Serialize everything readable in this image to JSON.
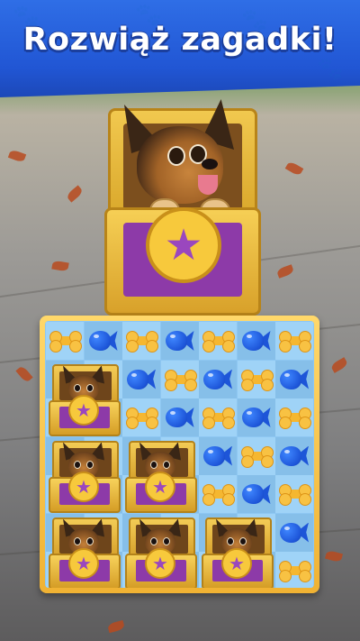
{
  "banner": {
    "title": "Rozwiąż zagadki!",
    "color": "#2156d4"
  },
  "hero": {
    "object": "treasure-chest",
    "character": "german-shepherd-puppy",
    "star_icon": "★"
  },
  "board": {
    "columns": 7,
    "rows": 7,
    "grid": [
      [
        "bone",
        "fish",
        "bone",
        "fish",
        "bone",
        "fish",
        "bone"
      ],
      [
        "chest",
        "chest",
        "fish",
        "bone",
        "fish",
        "bone",
        "fish"
      ],
      [
        "chest",
        "chest",
        "bone",
        "fish",
        "bone",
        "fish",
        "bone"
      ],
      [
        "chest",
        "chest",
        "chest",
        "chest",
        "fish",
        "bone",
        "fish"
      ],
      [
        "chest",
        "chest",
        "chest",
        "chest",
        "bone",
        "fish",
        "bone"
      ],
      [
        "chest",
        "chest",
        "chest",
        "chest",
        "chest",
        "chest",
        "fish"
      ],
      [
        "chest",
        "chest",
        "chest",
        "chest",
        "chest",
        "chest",
        "bone"
      ]
    ],
    "chests": [
      {
        "row": 1,
        "col": 0
      },
      {
        "row": 3,
        "col": 0
      },
      {
        "row": 3,
        "col": 2
      },
      {
        "row": 5,
        "col": 0
      },
      {
        "row": 5,
        "col": 2
      },
      {
        "row": 5,
        "col": 4
      }
    ],
    "colors": {
      "bone": "#f5b730",
      "fish": "#1d55d8",
      "board_frame": "#f0b233",
      "board_bg": "#8ec7f2"
    }
  }
}
